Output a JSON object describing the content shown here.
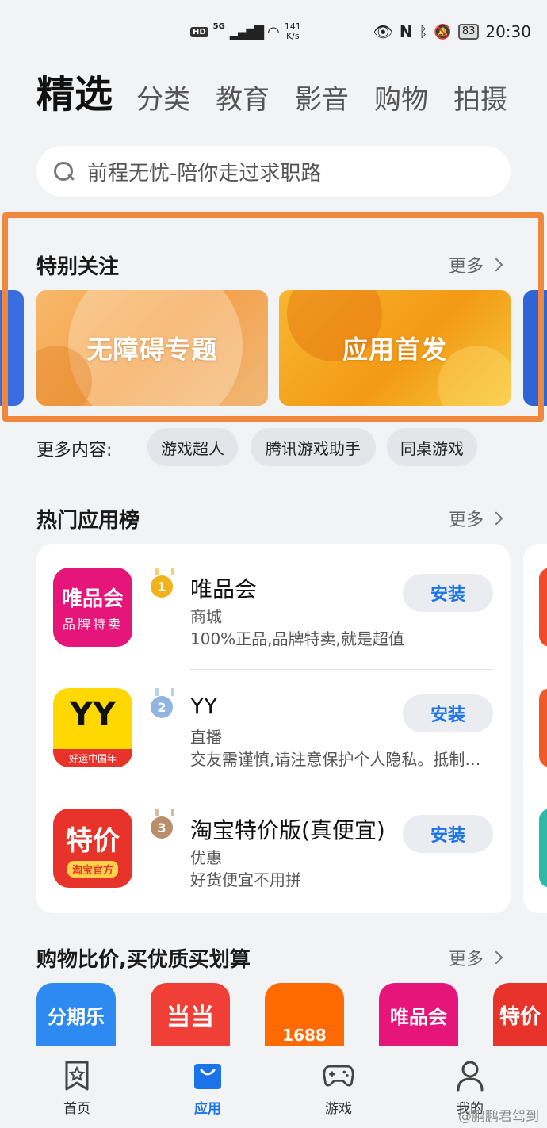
{
  "status_bar": {
    "hd": "HD",
    "network": "5G",
    "speed_value": "141",
    "speed_unit": "K/s",
    "battery": "83",
    "time": "20:30"
  },
  "top_tabs": [
    "精选",
    "分类",
    "教育",
    "影音",
    "购物",
    "拍摄"
  ],
  "search": {
    "placeholder": "前程无忧-陪你走过求职路"
  },
  "special": {
    "title": "特别关注",
    "more": "更多",
    "banners": [
      "无障碍专题",
      "应用首发"
    ]
  },
  "more_content": {
    "label": "更多内容:",
    "chips": [
      "游戏超人",
      "腾讯游戏助手",
      "同桌游戏"
    ]
  },
  "hot_apps": {
    "title": "热门应用榜",
    "more": "更多",
    "install_label": "安装",
    "items": [
      {
        "rank": "1",
        "name": "唯品会",
        "category": "商城",
        "desc": "100%正品,品牌特卖,就是超值",
        "icon_line1": "唯品会",
        "icon_line2": "品牌特卖",
        "icon_color": "#e5157a",
        "medal_color": "#f2b21c"
      },
      {
        "rank": "2",
        "name": "YY",
        "category": "直播",
        "desc": "交友需谨慎,请注意保护个人隐私。抵制低俗内容",
        "icon_line1": "YY",
        "icon_line2": "好运中国年",
        "icon_color": "#ffd800",
        "medal_color": "#8fb5e0"
      },
      {
        "rank": "3",
        "name": "淘宝特价版(真便宜)",
        "category": "优惠",
        "desc": "好货便宜不用拼",
        "icon_line1": "特价",
        "icon_line2": "淘宝官方",
        "icon_color": "#e8332a",
        "medal_color": "#b98e6a"
      }
    ]
  },
  "shopping": {
    "title": "购物比价,买优质买划算",
    "more": "更多",
    "icons": [
      {
        "label": "分期乐",
        "color": "#2c8af0"
      },
      {
        "label": "当当",
        "color": "#ef3f37"
      },
      {
        "label": "1688",
        "color": "#ff6a00"
      },
      {
        "label": "唯品会",
        "color": "#e5157a"
      },
      {
        "label": "特价",
        "color": "#e8332a"
      }
    ]
  },
  "bottom_nav": {
    "items": [
      {
        "label": "首页",
        "icon": "bookmark-star-icon"
      },
      {
        "label": "应用",
        "icon": "shopping-bag-icon"
      },
      {
        "label": "游戏",
        "icon": "gamepad-icon"
      },
      {
        "label": "我的",
        "icon": "person-icon"
      }
    ],
    "active": "应用"
  },
  "watermark": "@鹏鹏君驾到",
  "colors": {
    "accent": "#1a73e8",
    "highlight_border": "#f0873a"
  }
}
